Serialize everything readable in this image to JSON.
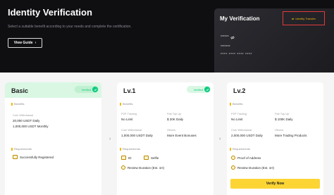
{
  "hero": {
    "title": "Identity Verification",
    "subtitle": "Select a suitable benefit according to your needs and complete the certification.",
    "view_guide": "View Guide"
  },
  "my_verification": {
    "title": "My Verification",
    "transfer_label": "Identity Transfer",
    "masked_name": "******",
    "masked_id": "*******",
    "masked_number": "**** **** **** ****"
  },
  "cards": {
    "basic": {
      "title": "Basic",
      "status": "Verified",
      "benefits_label": "Benefits",
      "coin_withdrawal_label": "Coin Withdrawal",
      "daily": "20,000 USDT Daily",
      "monthly": "1,000,000 USDT Monthly",
      "requirements_label": "Requirements",
      "req1": "Successfully Registered"
    },
    "lv1": {
      "title": "Lv.1",
      "status": "Verified",
      "benefits_label": "Benefits",
      "p2p_label": "P2P Trading",
      "p2p_value": "No Limit",
      "fiat_label": "Fiat Top Up",
      "fiat_value": "$ 20K Daily",
      "coin_label": "Coin Withdrawal",
      "coin_value": "1,000,000 USDT Daily",
      "others_label": "Others",
      "others_value": "More Event Bonuses",
      "requirements_label": "Requirements",
      "req1": "ID",
      "req2": "Selfie",
      "req3": "Review Duration (Est. 1H)"
    },
    "lv2": {
      "title": "Lv.2",
      "benefits_label": "Benefits",
      "p2p_label": "P2P Trading",
      "p2p_value": "No Limit",
      "fiat_label": "Fiat Top Up",
      "fiat_value": "$ 100K Daily",
      "coin_label": "Coin Withdrawal",
      "coin_value": "2,000,000 USDT Daily",
      "others_label": "Others",
      "others_value": "More Trading Products",
      "requirements_label": "Requirements",
      "req1": "Proof of Address",
      "req2": "Review Duration (Est. 1H)",
      "button": "Verify Now"
    }
  },
  "icons": {
    "arrow": "›",
    "check": "✓",
    "transfer": "⇄"
  },
  "colors": {
    "accent": "#fcd535",
    "verified": "#0ecb81",
    "highlight_box": "#e23a3a",
    "dark_bg": "#0f0f12"
  }
}
